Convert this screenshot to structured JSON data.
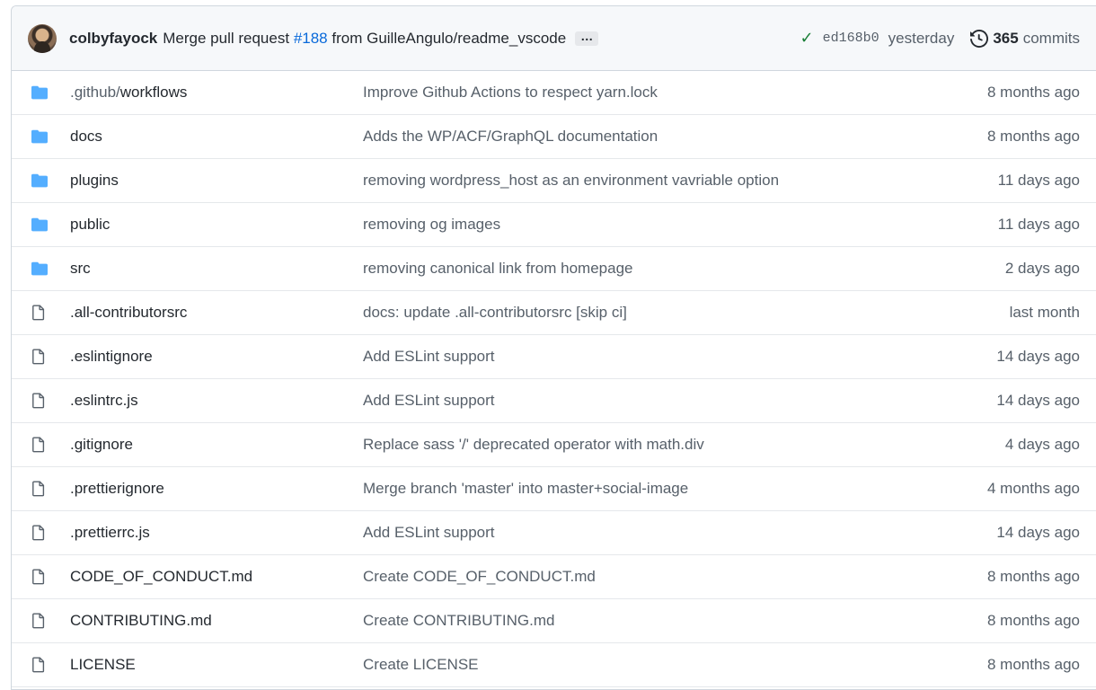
{
  "latest_commit": {
    "author": "colbyfayock",
    "message_prefix": "Merge pull request",
    "pr_number": "#188",
    "message_suffix": "from GuilleAngulo/readme_vscode",
    "ellipsis": "…",
    "sha": "ed168b0",
    "time": "yesterday",
    "commit_count": "365",
    "commit_label": "commits",
    "status_color": "#1a7f37"
  },
  "files": [
    {
      "type": "folder",
      "name_prefix": ".github/",
      "name": "workflows",
      "message": "Improve Github Actions to respect yarn.lock",
      "age": "8 months ago"
    },
    {
      "type": "folder",
      "name_prefix": "",
      "name": "docs",
      "message": "Adds the WP/ACF/GraphQL documentation",
      "age": "8 months ago"
    },
    {
      "type": "folder",
      "name_prefix": "",
      "name": "plugins",
      "message": "removing wordpress_host as an environment vavriable option",
      "age": "11 days ago"
    },
    {
      "type": "folder",
      "name_prefix": "",
      "name": "public",
      "message": "removing og images",
      "age": "11 days ago"
    },
    {
      "type": "folder",
      "name_prefix": "",
      "name": "src",
      "message": "removing canonical link from homepage",
      "age": "2 days ago"
    },
    {
      "type": "file",
      "name_prefix": "",
      "name": ".all-contributorsrc",
      "message": "docs: update .all-contributorsrc [skip ci]",
      "age": "last month"
    },
    {
      "type": "file",
      "name_prefix": "",
      "name": ".eslintignore",
      "message": "Add ESLint support",
      "age": "14 days ago"
    },
    {
      "type": "file",
      "name_prefix": "",
      "name": ".eslintrc.js",
      "message": "Add ESLint support",
      "age": "14 days ago"
    },
    {
      "type": "file",
      "name_prefix": "",
      "name": ".gitignore",
      "message": "Replace sass '/' deprecated operator with math.div",
      "age": "4 days ago"
    },
    {
      "type": "file",
      "name_prefix": "",
      "name": ".prettierignore",
      "message": "Merge branch 'master' into master+social-image",
      "age": "4 months ago"
    },
    {
      "type": "file",
      "name_prefix": "",
      "name": ".prettierrc.js",
      "message": "Add ESLint support",
      "age": "14 days ago"
    },
    {
      "type": "file",
      "name_prefix": "",
      "name": "CODE_OF_CONDUCT.md",
      "message": "Create CODE_OF_CONDUCT.md",
      "age": "8 months ago"
    },
    {
      "type": "file",
      "name_prefix": "",
      "name": "CONTRIBUTING.md",
      "message": "Create CONTRIBUTING.md",
      "age": "8 months ago"
    },
    {
      "type": "file",
      "name_prefix": "",
      "name": "LICENSE",
      "message": "Create LICENSE",
      "age": "8 months ago"
    }
  ],
  "colors": {
    "folder_icon": "#54aeff",
    "file_icon": "#57606a",
    "link": "#0969da"
  }
}
